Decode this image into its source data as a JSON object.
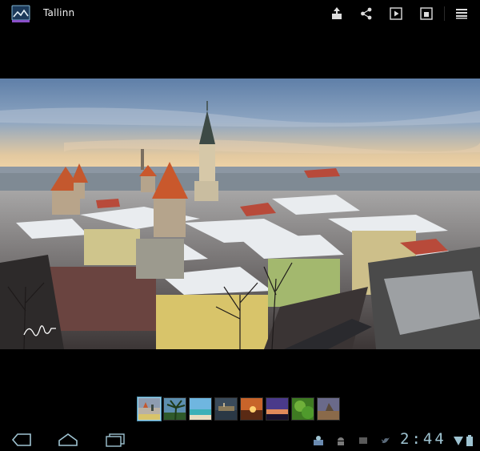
{
  "action_bar": {
    "title": "Tallinn",
    "icons": [
      "gallery-app-icon",
      "share-upload-icon",
      "share-icon",
      "slideshow-icon",
      "set-as-icon",
      "overflow-menu-icon"
    ]
  },
  "photo": {
    "watermark": "signature"
  },
  "filmstrip": {
    "selected_index": 0,
    "thumbnails": [
      "tallinn-city-thumb",
      "palm-tree-thumb",
      "beach-thumb",
      "harbor-thumb",
      "sunset-thumb",
      "dusk-sky-thumb",
      "green-foliage-thumb",
      "coast-thumb"
    ]
  },
  "system_bar": {
    "clock": "2:44",
    "icons": [
      "back-icon",
      "home-icon",
      "recent-apps-icon",
      "notification-user-icon",
      "notification-android-icon",
      "notification-message-icon",
      "notification-twitter-icon",
      "wifi-icon",
      "battery-icon"
    ]
  },
  "colors": {
    "background": "#000000",
    "accent": "#9fc4d2",
    "icon": "#dcdcdc",
    "selected_thumb_border": "#9ccfe8"
  }
}
